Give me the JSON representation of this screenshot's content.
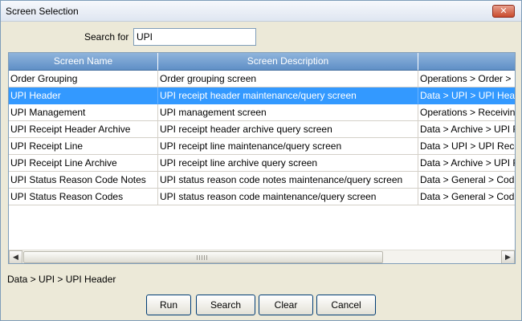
{
  "window": {
    "title": "Screen Selection",
    "close_glyph": "✕"
  },
  "search": {
    "label": "Search for",
    "value": "UPI"
  },
  "grid": {
    "columns": [
      "Screen Name",
      "Screen Description",
      ""
    ],
    "rows": [
      {
        "name": "Order Grouping",
        "description": "Order grouping screen",
        "path": "Operations > Order >",
        "selected": false
      },
      {
        "name": "UPI Header",
        "description": "UPI receipt header maintenance/query screen",
        "path": "Data > UPI > UPI Header",
        "selected": true
      },
      {
        "name": "UPI Management",
        "description": "UPI management screen",
        "path": "Operations > Receiving",
        "selected": false
      },
      {
        "name": "UPI Receipt Header Archive",
        "description": "UPI receipt header archive query screen",
        "path": "Data > Archive > UPI R",
        "selected": false
      },
      {
        "name": "UPI Receipt Line",
        "description": "UPI receipt line maintenance/query screen",
        "path": "Data > UPI > UPI Rece",
        "selected": false
      },
      {
        "name": "UPI Receipt Line Archive",
        "description": "UPI receipt line archive query screen",
        "path": "Data > Archive > UPI R",
        "selected": false
      },
      {
        "name": "UPI Status Reason Code Notes",
        "description": "UPI status reason code notes maintenance/query screen",
        "path": "Data > General > Cod",
        "selected": false
      },
      {
        "name": "UPI Status Reason Codes",
        "description": "UPI status reason code maintenance/query screen",
        "path": "Data > General > Cod",
        "selected": false
      }
    ]
  },
  "scrollbar": {
    "left_icon": "◀",
    "right_icon": "▶"
  },
  "status_path": "Data > UPI > UPI Header",
  "buttons": {
    "run": "Run",
    "search": "Search",
    "clear": "Clear",
    "cancel": "Cancel"
  },
  "colors": {
    "header": "#6a97cc",
    "selection": "#3399ff"
  }
}
